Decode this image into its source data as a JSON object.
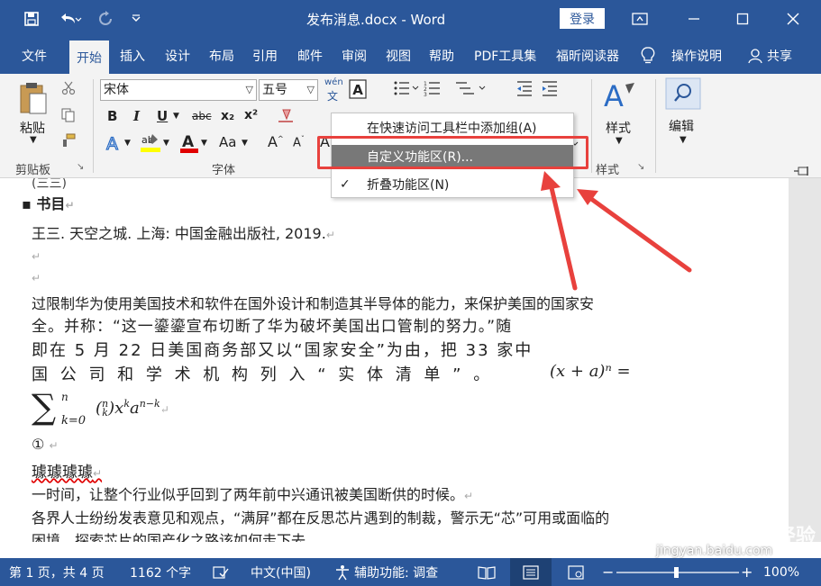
{
  "titlebar": {
    "title": "发布消息.docx  -  Word",
    "login": "登录",
    "icons": [
      "save-icon",
      "undo-icon",
      "redo-icon",
      "customize-qat-icon",
      "ribbon-display-icon",
      "minimize-icon",
      "maximize-icon",
      "close-icon"
    ]
  },
  "tabs": [
    "文件",
    "开始",
    "插入",
    "设计",
    "布局",
    "引用",
    "邮件",
    "审阅",
    "视图",
    "帮助",
    "PDF工具集",
    "福昕阅读器",
    "操作说明",
    "共享"
  ],
  "ribbon": {
    "clipboard": {
      "paste": "粘贴",
      "group": "剪贴板"
    },
    "font": {
      "name": "宋体",
      "size": "五号",
      "phonetic": "wén",
      "bold": "B",
      "italic": "I",
      "underline": "U",
      "strike": "abc",
      "subscript": "x₂",
      "superscript": "x²",
      "aa": "Aa",
      "group": "字体"
    },
    "styles": {
      "label": "样式",
      "group": "样式"
    },
    "editing": {
      "label": "编辑"
    }
  },
  "context_menu": {
    "items": [
      "在快速访问工具栏中添加组(A)",
      "自定义功能区(R)...",
      "折叠功能区(N)"
    ],
    "checked": "✓"
  },
  "document": {
    "lines": [
      "(三三)",
      "书目",
      "王三. 天空之城. 上海: 中国金融出版社, 2019.",
      "过限制华为使用美国技术和软件在国外设计和制造其半导体的能力，来保护美国的国家安",
      "全。并称：“这一鎏鎏宣布切断了华为破坏美国出口管制的努力。”随",
      "即在 5 月 22 日美国商务部又以“国家安全”为由，把 33 家中",
      "国 公 司 和 学 术 机 构 列 入 “ 实 体 清 单 ” 。",
      "(x + a)ⁿ =",
      "∑",
      "①",
      "璩璩璩璩",
      "一时间，让整个行业似乎回到了两年前中兴通讯被美国断供的时候。",
      "各界人士纷纷发表意见和观点，“满屏”都在反思芯片遇到的制裁，警示无“芯”可用或面临的",
      "困境，探索芯片的国产化之路该如何走下去。"
    ]
  },
  "statusbar": {
    "page": "第 1 页，共 4 页",
    "words": "1162 个字",
    "lang": "中文(中国)",
    "accessibility": "辅助功能: 调查",
    "zoom": "100%"
  },
  "watermark": {
    "brand": "Bai 经验",
    "url": "jingyan.baidu.com"
  },
  "colors": {
    "accent": "#2b579a",
    "menu_highlight": "#787878",
    "annotation": "#e8413d"
  }
}
